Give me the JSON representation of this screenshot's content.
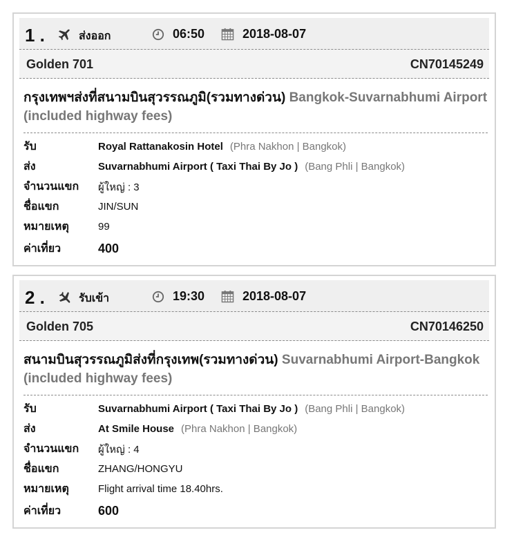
{
  "bookings": [
    {
      "index": "1 .",
      "trip_type": "ส่งออก",
      "time": "06:50",
      "date": "2018-08-07",
      "vehicle": "Golden 701",
      "code": "CN70145249",
      "route_th": "กรุงเทพฯส่งที่สนามบินสุวรรณภูมิ(รวมทางด่วน)",
      "route_en": "Bangkok-Suvarnabhumi Airport (included highway fees)",
      "pickup_label": "รับ",
      "pickup_place": "Royal Rattanakosin Hotel",
      "pickup_district": "(Phra Nakhon | Bangkok)",
      "dropoff_label": "ส่ง",
      "dropoff_place": "Suvarnabhumi Airport ( Taxi Thai By Jo )",
      "dropoff_district": "(Bang Phli | Bangkok)",
      "guests_label": "จำนวนแขก",
      "guests_value": "ผู้ใหญ่ : 3",
      "name_label": "ชื่อแขก",
      "name_value": "JIN/SUN",
      "note_label": "หมายเหตุ",
      "note_value": "99",
      "fare_label": "ค่าเที่ยว",
      "fare_value": "400"
    },
    {
      "index": "2 .",
      "trip_type": "รับเข้า",
      "time": "19:30",
      "date": "2018-08-07",
      "vehicle": "Golden 705",
      "code": "CN70146250",
      "route_th": "สนามบินสุวรรณภูมิส่งที่กรุงเทพ(รวมทางด่วน)",
      "route_en": "Suvarnabhumi Airport-Bangkok (included highway fees)",
      "pickup_label": "รับ",
      "pickup_place": "Suvarnabhumi Airport ( Taxi Thai By Jo )",
      "pickup_district": "(Bang Phli | Bangkok)",
      "dropoff_label": "ส่ง",
      "dropoff_place": "At Smile House",
      "dropoff_district": "(Phra Nakhon | Bangkok)",
      "guests_label": "จำนวนแขก",
      "guests_value": "ผู้ใหญ่ : 4",
      "name_label": "ชื่อแขก",
      "name_value": "ZHANG/HONGYU",
      "note_label": "หมายเหตุ",
      "note_value": "Flight arrival time 18.40hrs.",
      "fare_label": "ค่าเที่ยว",
      "fare_value": "600"
    }
  ],
  "icons": {
    "departure": "plane-takeoff-icon",
    "arrival": "plane-landing-icon",
    "clock": "clock-icon",
    "calendar": "calendar-icon"
  }
}
